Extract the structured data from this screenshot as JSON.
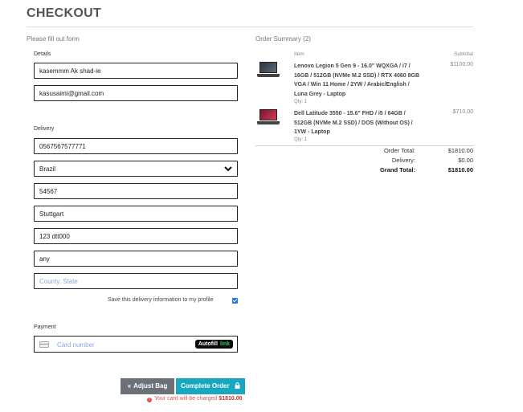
{
  "page": {
    "title": "CHECKOUT"
  },
  "form": {
    "heading": "Please fill out form",
    "details": {
      "label": "Details",
      "name_value": "kasemmm Ak shad-ie",
      "email_value": "kasusaimi@gmail.com"
    },
    "delivery": {
      "label": "Delivery",
      "phone_value": "0567567577771",
      "country_value": "Brazil",
      "postcode_value": "54567",
      "city_value": "Stuttgart",
      "address_value": "123 dtt000",
      "address2_value": "any",
      "region_placeholder": "County, State"
    },
    "save_label": "Save this delivery information to my profile",
    "save_checked": true,
    "payment": {
      "label": "Payment",
      "card_placeholder": "Card number",
      "autofill_label": "Autofill",
      "autofill_link": "link"
    },
    "adjust_button": "Adjust Bag",
    "complete_button": "Complete Order",
    "charge_note_prefix": "Your card will be charged",
    "charge_amount": "$1810.00"
  },
  "summary": {
    "heading": "Order Summary (2)",
    "col_item": "Item",
    "col_subtotal": "Subtotal",
    "items": [
      {
        "name": "Lenovo Legion 5 Gen 9 - 16.0\" WQXGA / i7 / 16GB / 512GB (NVMe M.2 SSD) / RTX 4060 8GB VGA / Win 11 Home / 2YW / Arabic/English / Luna Grey - Laptop",
        "qty": "Qty: 1",
        "price": "$1100.00"
      },
      {
        "name": "Dell Latitude 3550 - 15.6\" FHD / i5 / 64GB / 512GB (NVMe M.2 SSD) / DOS (Without OS) / 1YW - Laptop",
        "qty": "Qty: 1",
        "price": "$710.00"
      }
    ],
    "order_total_label": "Order Total:",
    "order_total": "$1810.00",
    "delivery_label": "Delivery:",
    "delivery": "$0.00",
    "grand_total_label": "Grand Total:",
    "grand_total": "$1810.00"
  },
  "colors": {
    "accent": "#17a7c1",
    "secondary_button": "#6b7177",
    "error": "#d9534f",
    "placeholder": "#8aa8d6"
  }
}
